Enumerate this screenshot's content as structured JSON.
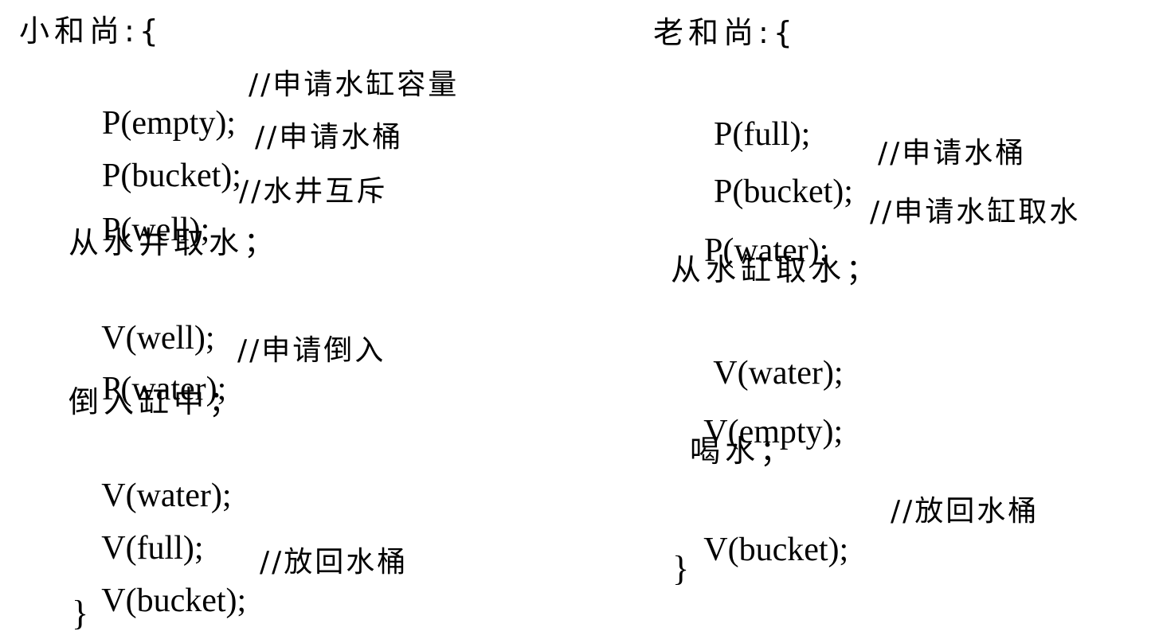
{
  "left": {
    "header": "小和尚:{",
    "lines": [
      {
        "code": "P(empty);",
        "comment": "//申请水缸容量"
      },
      {
        "code": "P(bucket);",
        "comment": "//申请水桶"
      },
      {
        "code": "P(well);",
        "comment": "//水井互斥"
      },
      {
        "text": "从水井取水；"
      },
      {
        "code": "V(well);"
      },
      {
        "code": "P(water);",
        "comment": "//申请倒入"
      },
      {
        "text": "倒入缸中；"
      },
      {
        "code": "V(water);"
      },
      {
        "code": "V(full);"
      },
      {
        "code": "V(bucket);",
        "comment": "//放回水桶"
      }
    ],
    "close": "}"
  },
  "right": {
    "header": "老和尚:{",
    "lines": [
      {
        "code": "P(full);"
      },
      {
        "code": "P(bucket);",
        "comment": "//申请水桶"
      },
      {
        "code": "P(water);",
        "comment": "//申请水缸取水"
      },
      {
        "text": "从水缸取水；"
      },
      {
        "code": "V(water);"
      },
      {
        "code": "V(empty);"
      },
      {
        "text": "喝水；"
      },
      {
        "code": "V(bucket);",
        "comment": "//放回水桶"
      }
    ],
    "close": "}"
  }
}
